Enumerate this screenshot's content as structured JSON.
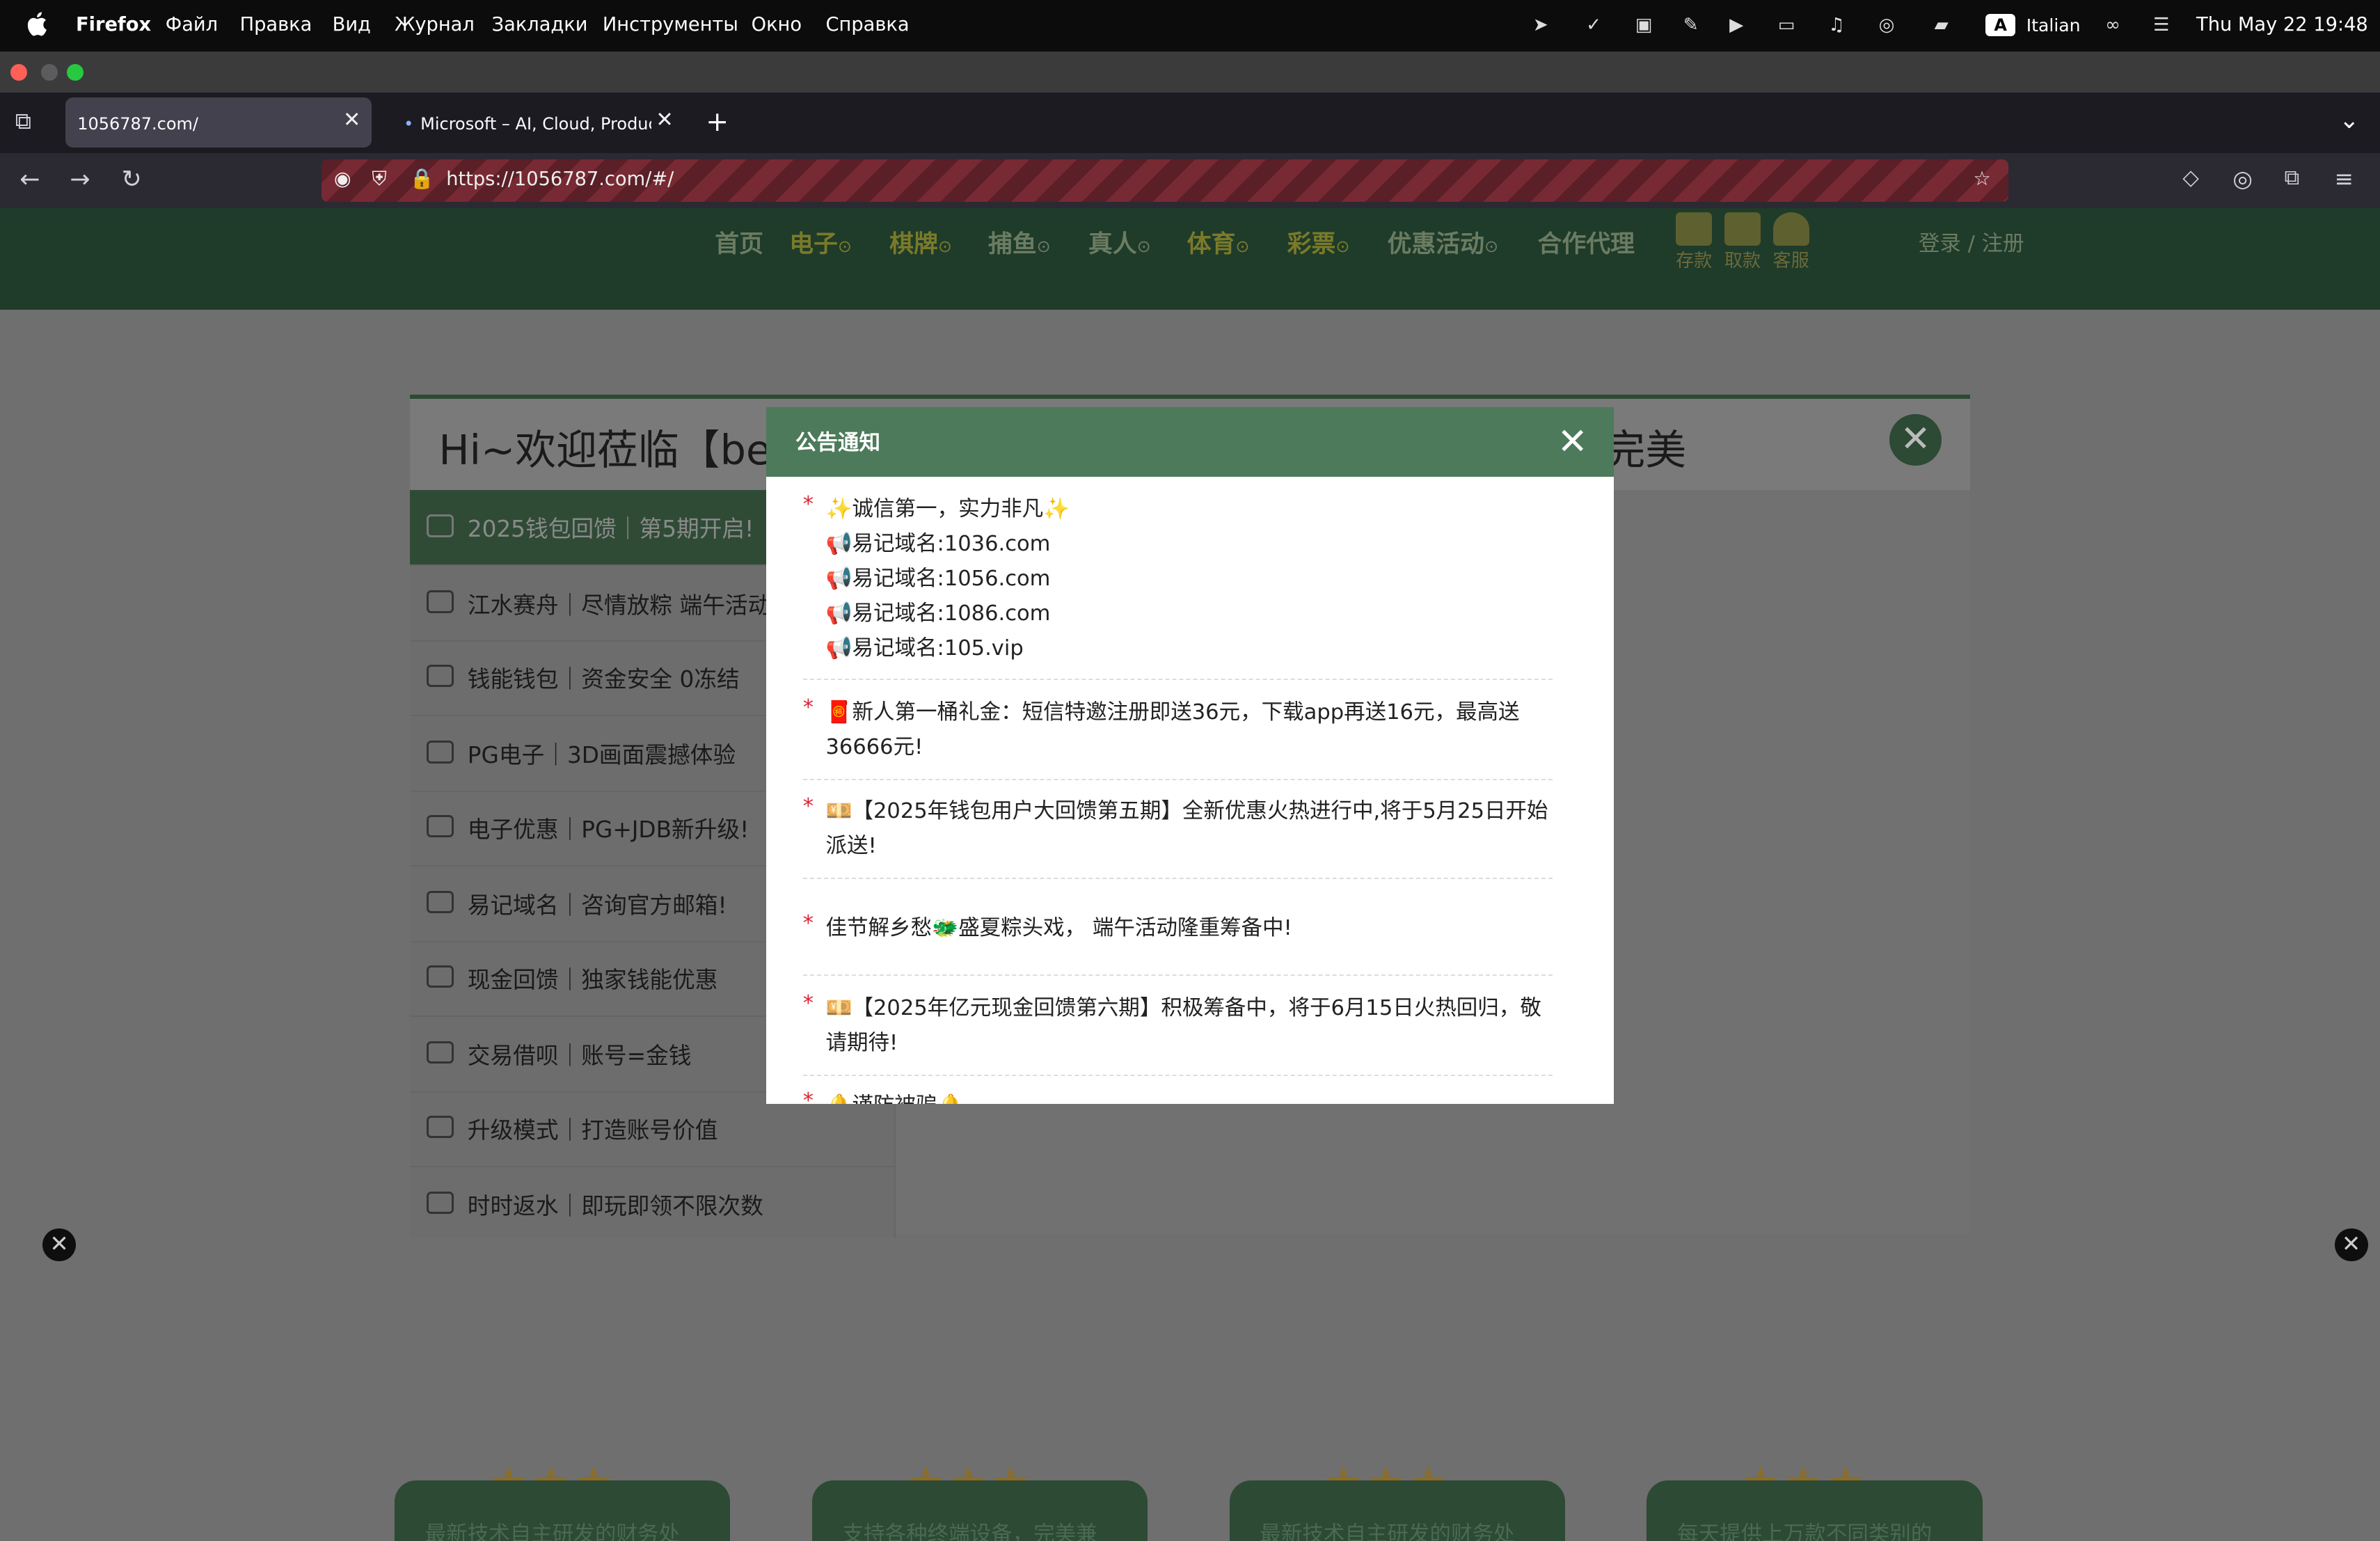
{
  "menubar": {
    "app": "Firefox",
    "items": [
      "Файл",
      "Правка",
      "Вид",
      "Журнал",
      "Закладки",
      "Инструменты",
      "Окно",
      "Справка"
    ],
    "input_source": "Italian",
    "datetime": "Thu May 22  19:48"
  },
  "browser": {
    "tabs": [
      {
        "title": "1056787.com/",
        "close": "✕"
      },
      {
        "title": "Microsoft – AI, Cloud, Productiv",
        "close": "✕"
      }
    ],
    "new_tab": "+",
    "url": "https://1056787.com/#/",
    "colors": {
      "private_stripe": "#772a33"
    }
  },
  "site": {
    "nav": [
      {
        "label": "首页"
      },
      {
        "label": "电子",
        "dot": "⊙"
      },
      {
        "label": "棋牌",
        "dot": "⊙"
      },
      {
        "label": "捕鱼",
        "dot": "⊙"
      },
      {
        "label": "真人",
        "dot": "⊙"
      },
      {
        "label": "体育",
        "dot": "⊙"
      },
      {
        "label": "彩票",
        "dot": "⊙"
      },
      {
        "label": "优惠活动",
        "dot": "⊙"
      },
      {
        "label": "合作代理"
      }
    ],
    "quick": [
      "存款",
      "取款",
      "客服"
    ],
    "login": "登录 / 注册",
    "theme_color": "#1f3b2a"
  },
  "welcome": {
    "title_left": "Hi~欢迎莅临【be",
    "title_right": "优完美",
    "sidebar": [
      "2025钱包回馈｜第5期开启!",
      "江水赛舟｜尽情放粽 端午活动",
      "钱能钱包｜资金安全 0冻结",
      "PG电子｜3D画面震撼体验",
      "电子优惠｜PG+JDB新升级!",
      "易记域名｜咨询官方邮箱!",
      "现金回馈｜独家钱能优惠",
      "交易借呗｜账号=金钱",
      "升级模式｜打造账号价值",
      "时时返水｜即玩即领不限次数"
    ]
  },
  "notice": {
    "title": "公告通知",
    "entries": [
      {
        "lines": [
          "✨诚信第一，实力非凡✨",
          "📢易记域名:1036.com",
          "📢易记域名:1056.com",
          "📢易记域名:1086.com",
          "📢易记域名:105.vip"
        ]
      },
      {
        "lines": [
          "🧧新人第一桶礼金：短信特邀注册即送36元，下载app再送16元，最高送36666元!"
        ]
      },
      {
        "lines": [
          "💴【2025年钱包用户大回馈第五期】全新优惠火热进行中,将于5月25日开始派送!"
        ]
      },
      {
        "lines": [
          "佳节解乡愁🐲盛夏粽头戏， 端午活动隆重筹备中!"
        ]
      },
      {
        "lines": [
          "💴【2025年亿元现金回馈第六期】积极筹备中，将于6月15日火热回归，敬请期待!"
        ]
      },
      {
        "lines": [
          "🔔谨防被骗🔔"
        ]
      }
    ]
  },
  "features": [
    {
      "text": "最新技术自主研发的财务处"
    },
    {
      "text": "支持各种终端设备，完美兼"
    },
    {
      "text": "最新技术自主研发的财务处"
    },
    {
      "text": "每天提供上万款不同类别的"
    }
  ],
  "stars": "★★★"
}
